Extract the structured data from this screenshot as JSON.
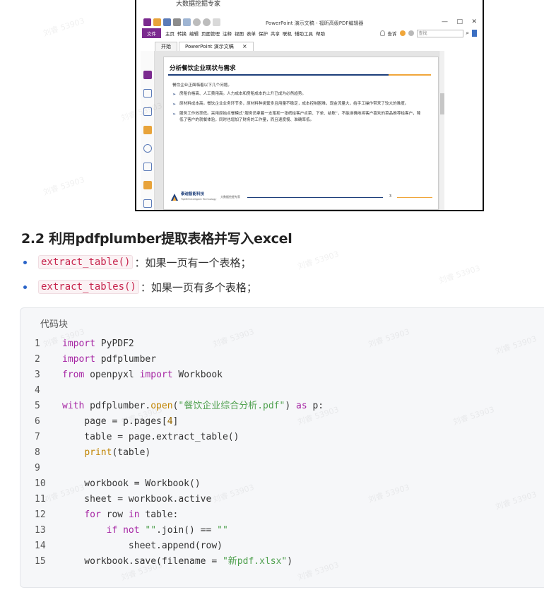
{
  "screenshot": {
    "top_caption": "大数据挖掘专家",
    "app_title": "PowerPoint 演示文稿 - 福昕高级PDF编辑器",
    "window_controls": [
      "—",
      "□",
      "✕"
    ],
    "menu": {
      "file": "文件",
      "items": [
        "主页",
        "转换",
        "编辑",
        "页面管理",
        "注释",
        "视图",
        "表单",
        "保护",
        "共享",
        "联机",
        "辅助工具",
        "帮助"
      ],
      "right_items": [
        "告诉",
        "查找"
      ]
    },
    "tabs": [
      {
        "label": "开始",
        "active": false
      },
      {
        "label": "PowerPoint 演示文稿",
        "active": true
      }
    ],
    "tab_close": "×",
    "pdf_page": {
      "title": "分析餐饮企业现状与需求",
      "intro": "餐饮企业正面临着以下几个问题。",
      "bullets": [
        "房租价格高、人工费用高。人力成本和房租成本的上升已成为必然趋势。",
        "原材料成本高。餐饮企业业务环节多，原材料种类繁多且用量不稳定，成本控制困难，现金流量大，给手工操作带来了较大的难度。",
        "服务工作效率低。采用原始点餐模式“服务员拿着一支笔和一张纸给客户点菜、下单、结账”，不能准确地将客户喜欢的菜品推荐给客户，降低了客户的就餐体验，同时也增加了财务的工作量，而且速度慢、准确率低。"
      ],
      "footer_brand": "泰迪智能科技",
      "footer_brand_sub": "TipDM Intelligent Technology",
      "footer_tag": "大数据挖掘专家",
      "page_number": "3"
    }
  },
  "article": {
    "heading": "2.2 利用pdfplumber提取表格并写入excel",
    "list": [
      {
        "code": "extract_table()",
        "desc": "：如果一页有一个表格；"
      },
      {
        "code": "extract_tables()",
        "desc": "：如果一页有多个表格；"
      }
    ],
    "code_block": {
      "title": "代码块",
      "lines": [
        {
          "n": "1",
          "html": "<span class=\"kw\">import</span> PyPDF2"
        },
        {
          "n": "2",
          "html": "<span class=\"kw\">import</span> pdfplumber"
        },
        {
          "n": "3",
          "html": "<span class=\"kw\">from</span> openpyxl <span class=\"kw\">import</span> Workbook"
        },
        {
          "n": "4",
          "html": ""
        },
        {
          "n": "5",
          "html": "<span class=\"kw\">with</span> pdfplumber.<span class=\"fn\">open</span>(<span class=\"str\">\"餐饮企业综合分析.pdf\"</span>) <span class=\"kw\">as</span> p:"
        },
        {
          "n": "6",
          "html": "    page = p.pages[<span class=\"num\">4</span>]"
        },
        {
          "n": "7",
          "html": "    table = page.extract_table()"
        },
        {
          "n": "8",
          "html": "    <span class=\"fn\">print</span>(table)"
        },
        {
          "n": "9",
          "html": ""
        },
        {
          "n": "10",
          "html": "    workbook = Workbook()"
        },
        {
          "n": "11",
          "html": "    sheet = workbook.active"
        },
        {
          "n": "12",
          "html": "    <span class=\"kw\">for</span> row <span class=\"kw\">in</span> table:"
        },
        {
          "n": "13",
          "html": "        <span class=\"kw\">if</span> <span class=\"kw\">not</span> <span class=\"str\">\"\"</span>.join() == <span class=\"str\">\"\"</span>"
        },
        {
          "n": "14",
          "html": "            sheet.append(row)"
        },
        {
          "n": "15",
          "html": "    workbook.save(filename = <span class=\"str\">\"新pdf.xlsx\"</span>)"
        }
      ]
    }
  },
  "watermark": "刘睿 53903",
  "colors": {
    "accent_purple": "#7b2a8f",
    "pdf_navy": "#1d3e7a",
    "pdf_orange": "#f0a63a",
    "code_inline": "#c7254e",
    "bullet_blue": "#2a64c8",
    "keyword": "#a626a4",
    "string": "#50a14f",
    "builtin": "#c18401"
  },
  "icons": [
    "app-logo-icon",
    "open-icon",
    "save-icon",
    "print-icon",
    "undo-icon",
    "redo-icon",
    "hand-icon",
    "pages-icon",
    "bookmark-icon",
    "signature-icon",
    "comment-icon",
    "attachment-icon",
    "stamp-icon",
    "lock-icon",
    "layers-icon",
    "lightbulb-icon",
    "search-icon"
  ]
}
